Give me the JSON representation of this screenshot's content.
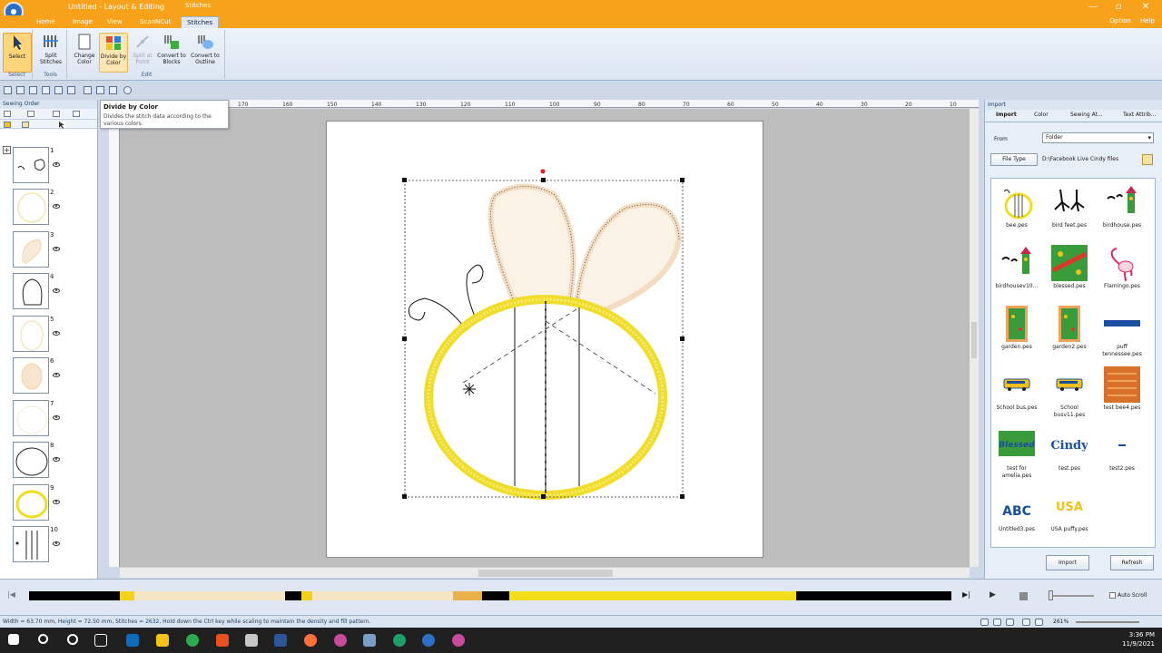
{
  "window": {
    "title": "Untitled - Layout & Editing",
    "context_tab": "Stitches"
  },
  "menu": {
    "tabs": [
      "Home",
      "Image",
      "View",
      "ScanNCut",
      "Stitches"
    ],
    "active_tab": "Stitches",
    "right": [
      "Option",
      "Help"
    ]
  },
  "ribbon": {
    "groups": [
      {
        "label": "Select",
        "buttons": [
          {
            "label": "Select"
          }
        ]
      },
      {
        "label": "Tools",
        "buttons": [
          {
            "label": "Split Stitches"
          }
        ]
      },
      {
        "label": "Edit",
        "buttons": [
          {
            "label": "Change Color"
          },
          {
            "label": "Divide by Color"
          },
          {
            "label": "Split at Point"
          },
          {
            "label": "Convert to Blocks"
          },
          {
            "label": "Convert to Outline"
          }
        ]
      }
    ]
  },
  "tooltip": {
    "title": "Divide by Color",
    "desc": "Divides the stitch data according to the various colors."
  },
  "left_panel": {
    "title": "Sewing Order",
    "items": [
      "1",
      "2",
      "3",
      "4",
      "5",
      "6",
      "7",
      "8",
      "9",
      "10"
    ]
  },
  "right_panel": {
    "title": "Import",
    "tabs": [
      "Import",
      "Color",
      "Sewing At...",
      "Text Attrib..."
    ],
    "from_label": "From",
    "from_value": "Folder",
    "file_type_label": "File Type",
    "path": "D:\\Facebook Live Cindy files",
    "files": [
      "bee.pes",
      "bird feet.pes",
      "birdhouse.pes",
      "birdhousev10...",
      "blessed.pes",
      "Flamingo.pes",
      "garden.pes",
      "garden2.pes",
      "puff tennessee.pes",
      "School bus.pes",
      "School busv11.pes",
      "test bee4.pes",
      "test for amelia.pes",
      "test.pes",
      "test2.pes",
      "Untitled3.pes",
      "USA puffy.pes"
    ],
    "thumb_text": {
      "test": "Cindy",
      "usa": "USA",
      "untitled3": "ABC",
      "blessed_test": "Blessed"
    },
    "import_button": "Import",
    "refresh_button": "Refresh"
  },
  "ruler_labels": [
    "170",
    "160",
    "150",
    "140",
    "130",
    "120",
    "110",
    "100",
    "90",
    "80",
    "70",
    "60",
    "50",
    "40",
    "30",
    "20",
    "10"
  ],
  "timeline": {
    "auto_scroll_label": "Auto Scroll",
    "segments_colors": [
      "#000000",
      "#f5d21a",
      "#f7e6c6",
      "#000000",
      "#f5d21a",
      "#f7e6c6",
      "#e9b04c",
      "#000000",
      "#f2dd18",
      "#000000"
    ]
  },
  "status": {
    "text": "Width = 63.70 mm, Height = 72.50 mm, Stitches = 2632, Hold down the Ctrl key while scaling to maintain the density and fill pattern.",
    "zoom": "261%"
  },
  "taskbar": {
    "time": "3:36 PM",
    "date": "11/9/2021"
  },
  "colors": {
    "titlebar": "#f7a21a",
    "ribbon_bg": "#dbe5f2",
    "bee_yellow": "#f2e23a",
    "wing": "#f3dfc8"
  }
}
